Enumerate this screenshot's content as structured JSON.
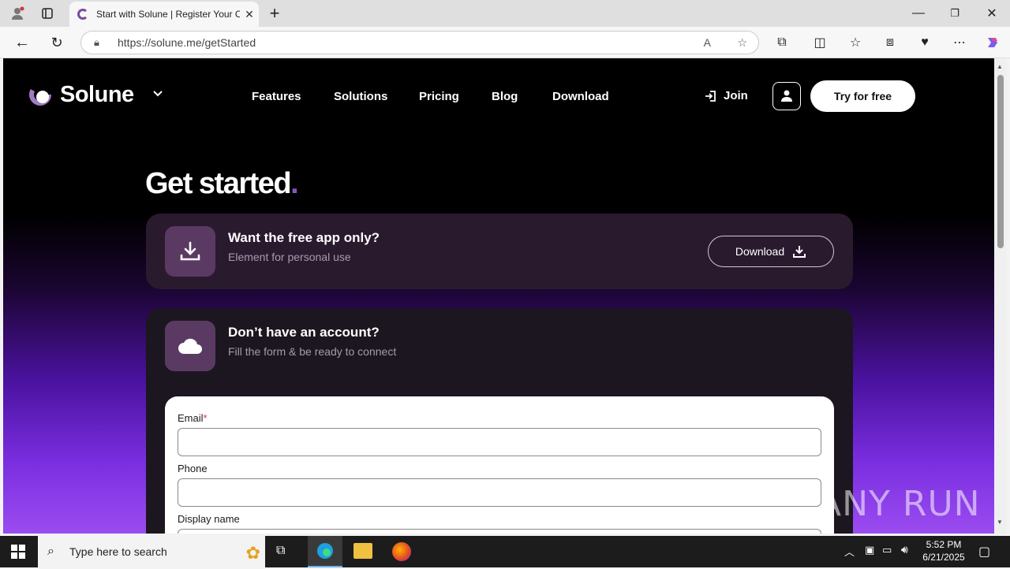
{
  "browser": {
    "tab_title": "Start with Solune | Register Your C",
    "url": "https://solune.me/getStarted"
  },
  "site": {
    "logo_text": "Solune",
    "nav": [
      {
        "label": "Features"
      },
      {
        "label": "Solutions"
      },
      {
        "label": "Pricing"
      },
      {
        "label": "Blog"
      },
      {
        "label": "Download"
      }
    ],
    "join_label": "Join",
    "try_label": "Try for free"
  },
  "main": {
    "heading": "Get started",
    "heading_dot": ".",
    "app_card": {
      "title": "Want the free app only?",
      "subtitle": "Element for personal use",
      "button_label": "Download"
    },
    "account_card": {
      "title": "Don’t have an account?",
      "subtitle": "Fill the form & be ready to connect"
    },
    "form": {
      "email_label": "Email",
      "required_mark": "*",
      "phone_label": "Phone",
      "display_name_label": "Display name"
    }
  },
  "watermark": "ANY RUN",
  "taskbar": {
    "search_placeholder": "Type here to search",
    "time": "5:52 PM",
    "date": "6/21/2025"
  },
  "colors": {
    "accent": "#7a4b9e",
    "card_bg": "#2a1a2e",
    "icon_box": "#5a3a63"
  }
}
